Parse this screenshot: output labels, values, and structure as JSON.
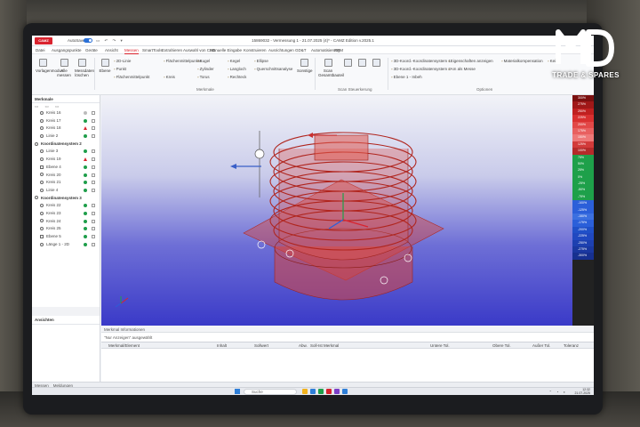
{
  "brand": {
    "logo_text": "MD",
    "tagline": "TRADE & SPARES"
  },
  "app": {
    "badge": "CAMZ",
    "autosave_label": "AutoSave",
    "window_title": "15869032 - Vermessung 1 - 21.07.2025 (4)*  - CAMZ Edition v.2025.1",
    "menu": [
      "Datei",
      "Ausgangspunkte",
      "Geräte",
      "Ansicht",
      "Messen",
      "SmartTools",
      "Extrahieren",
      "Auswahl von CAD",
      "Manuelle Eingabe",
      "Konstruieren",
      "Ausrichtungen",
      "GD&T",
      "Automatisierung",
      "RPM"
    ],
    "active_menu": "Messen"
  },
  "ribbon": {
    "big_buttons": [
      "Vorlagenmodus",
      "Alle messen",
      "Messdaten löschen",
      "Ebene"
    ],
    "small_col1": [
      "2D-Linie",
      "Punkt",
      "Flächenmittelpunkt"
    ],
    "small_col2": [
      "Flächenmittelpunkte",
      "Kreis"
    ],
    "small_col3": [
      "Kugel",
      "Zylinder",
      "Torus"
    ],
    "small_col4": [
      "Kegel",
      "Langloch",
      "Rechteck"
    ],
    "small_col5": [
      "Ellipse",
      "Querschnittsanalyse"
    ],
    "mid_buttons": [
      "Kurve",
      "Sonstige",
      "Scan Gesamtbauteil"
    ],
    "right_small": [
      "3D-Koord.-Koordinatensystem 1",
      "3D-Koord.-Koordinatensystem 2",
      "Ebene 1 - Inbeh"
    ],
    "options": [
      "Eigenschaften anzeigen",
      "Materialkompensation",
      "Keine",
      "Am als Messe"
    ],
    "groups": [
      "Merkmale",
      "Scan Steuerkerung",
      "Optionen"
    ]
  },
  "tree": {
    "header": "Merkmale",
    "rows": [
      {
        "label": "Kreis 16",
        "icon": "circle",
        "status": "grey"
      },
      {
        "label": "Kreis 17",
        "icon": "circle",
        "status": "ok"
      },
      {
        "label": "Kreis 18",
        "icon": "circle",
        "status": "warn"
      },
      {
        "label": "Linie 2",
        "icon": "line",
        "status": "ok"
      },
      {
        "label": "Koordinatensystem 2",
        "icon": "group",
        "status": ""
      },
      {
        "label": "Linie 3",
        "icon": "line",
        "status": "ok"
      },
      {
        "label": "Kreis 19",
        "icon": "circle",
        "status": "warn"
      },
      {
        "label": "Ebene 4",
        "icon": "plane",
        "status": "ok"
      },
      {
        "label": "Kreis 20",
        "icon": "circle",
        "status": "ok"
      },
      {
        "label": "Kreis 21",
        "icon": "circle",
        "status": "ok"
      },
      {
        "label": "Linie 4",
        "icon": "line",
        "status": "ok"
      },
      {
        "label": "Koordinatensystem 3",
        "icon": "group",
        "status": ""
      },
      {
        "label": "Kreis 22",
        "icon": "circle",
        "status": "ok"
      },
      {
        "label": "Kreis 23",
        "icon": "circle",
        "status": "ok"
      },
      {
        "label": "Kreis 24",
        "icon": "circle",
        "status": "ok"
      },
      {
        "label": "Kreis 25",
        "icon": "circle",
        "status": "ok"
      },
      {
        "label": "Ebene 5",
        "icon": "plane",
        "status": "ok"
      },
      {
        "label": "Länge 1 - 2D",
        "icon": "line",
        "status": "ok"
      }
    ]
  },
  "bottom": {
    "tabs_label": "Merkmal Informationen",
    "left_title": "Ansichten",
    "message": "\"Nur Anzeigen\" ausgewählt",
    "columns": [
      "Merkmal/Element",
      "Inhalt",
      "Sollwert",
      "Abw.",
      "Soll-Ist Merkmal",
      "Untere Tol.",
      "Obere Tol.",
      "Außer Tol.",
      "Toleranz"
    ],
    "status_tabs": [
      "Messen",
      "Meldungen"
    ]
  },
  "scale": {
    "labels": [
      "300%",
      "275%",
      "250%",
      "225%",
      "200%",
      "175%",
      "150%",
      "125%",
      "100%",
      "75%",
      "50%",
      "25%",
      "0%",
      "-25%",
      "-50%",
      "-75%",
      "-100%",
      "-125%",
      "-150%",
      "-175%",
      "-200%",
      "-225%",
      "-250%",
      "-275%",
      "-300%"
    ],
    "colors": [
      "#7b1010",
      "#a01818",
      "#c02020",
      "#d93030",
      "#e24848",
      "#e86060",
      "#ee7878",
      "#d23a3a",
      "#b52a2a",
      "#1ea04a",
      "#1ea04a",
      "#1ea04a",
      "#1ea04a",
      "#1ea04a",
      "#1ea04a",
      "#1ea04a",
      "#2b5fd9",
      "#2b5fd9",
      "#3b6fe0",
      "#2b5fd9",
      "#2050c8",
      "#2048c0",
      "#1d40b0",
      "#1a38a0",
      "#163090"
    ]
  },
  "taskbar": {
    "search": "Suche",
    "time": "12:32",
    "date": "21.07.2025",
    "app_colors": [
      "#f2b21c",
      "#2f7fd8",
      "#1ea04a",
      "#d9232e",
      "#7b3fc8",
      "#2f7fd8"
    ]
  },
  "colors": {
    "accent": "#d9232e",
    "viewport_top": "#f2f3f8",
    "viewport_bottom": "#3a3ac8",
    "part": "#d8453c"
  }
}
